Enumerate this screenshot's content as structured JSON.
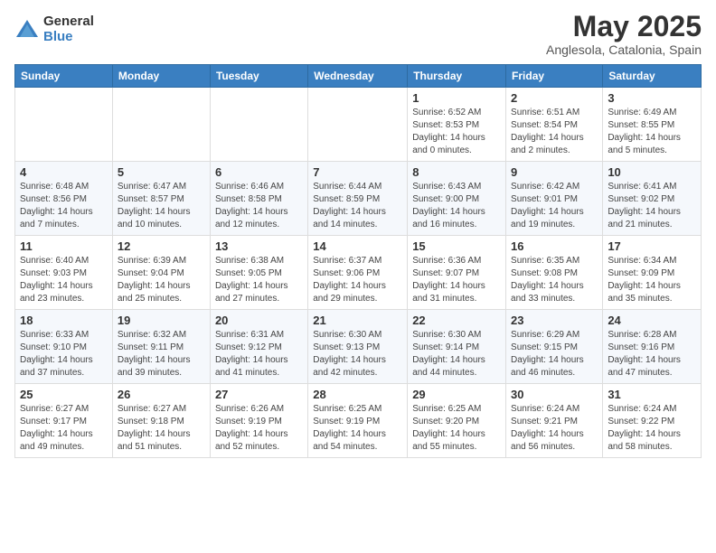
{
  "header": {
    "logo_general": "General",
    "logo_blue": "Blue",
    "title": "May 2025",
    "subtitle": "Anglesola, Catalonia, Spain"
  },
  "days_of_week": [
    "Sunday",
    "Monday",
    "Tuesday",
    "Wednesday",
    "Thursday",
    "Friday",
    "Saturday"
  ],
  "weeks": [
    [
      {
        "day": "",
        "info": ""
      },
      {
        "day": "",
        "info": ""
      },
      {
        "day": "",
        "info": ""
      },
      {
        "day": "",
        "info": ""
      },
      {
        "day": "1",
        "info": "Sunrise: 6:52 AM\nSunset: 8:53 PM\nDaylight: 14 hours and 0 minutes."
      },
      {
        "day": "2",
        "info": "Sunrise: 6:51 AM\nSunset: 8:54 PM\nDaylight: 14 hours and 2 minutes."
      },
      {
        "day": "3",
        "info": "Sunrise: 6:49 AM\nSunset: 8:55 PM\nDaylight: 14 hours and 5 minutes."
      }
    ],
    [
      {
        "day": "4",
        "info": "Sunrise: 6:48 AM\nSunset: 8:56 PM\nDaylight: 14 hours and 7 minutes."
      },
      {
        "day": "5",
        "info": "Sunrise: 6:47 AM\nSunset: 8:57 PM\nDaylight: 14 hours and 10 minutes."
      },
      {
        "day": "6",
        "info": "Sunrise: 6:46 AM\nSunset: 8:58 PM\nDaylight: 14 hours and 12 minutes."
      },
      {
        "day": "7",
        "info": "Sunrise: 6:44 AM\nSunset: 8:59 PM\nDaylight: 14 hours and 14 minutes."
      },
      {
        "day": "8",
        "info": "Sunrise: 6:43 AM\nSunset: 9:00 PM\nDaylight: 14 hours and 16 minutes."
      },
      {
        "day": "9",
        "info": "Sunrise: 6:42 AM\nSunset: 9:01 PM\nDaylight: 14 hours and 19 minutes."
      },
      {
        "day": "10",
        "info": "Sunrise: 6:41 AM\nSunset: 9:02 PM\nDaylight: 14 hours and 21 minutes."
      }
    ],
    [
      {
        "day": "11",
        "info": "Sunrise: 6:40 AM\nSunset: 9:03 PM\nDaylight: 14 hours and 23 minutes."
      },
      {
        "day": "12",
        "info": "Sunrise: 6:39 AM\nSunset: 9:04 PM\nDaylight: 14 hours and 25 minutes."
      },
      {
        "day": "13",
        "info": "Sunrise: 6:38 AM\nSunset: 9:05 PM\nDaylight: 14 hours and 27 minutes."
      },
      {
        "day": "14",
        "info": "Sunrise: 6:37 AM\nSunset: 9:06 PM\nDaylight: 14 hours and 29 minutes."
      },
      {
        "day": "15",
        "info": "Sunrise: 6:36 AM\nSunset: 9:07 PM\nDaylight: 14 hours and 31 minutes."
      },
      {
        "day": "16",
        "info": "Sunrise: 6:35 AM\nSunset: 9:08 PM\nDaylight: 14 hours and 33 minutes."
      },
      {
        "day": "17",
        "info": "Sunrise: 6:34 AM\nSunset: 9:09 PM\nDaylight: 14 hours and 35 minutes."
      }
    ],
    [
      {
        "day": "18",
        "info": "Sunrise: 6:33 AM\nSunset: 9:10 PM\nDaylight: 14 hours and 37 minutes."
      },
      {
        "day": "19",
        "info": "Sunrise: 6:32 AM\nSunset: 9:11 PM\nDaylight: 14 hours and 39 minutes."
      },
      {
        "day": "20",
        "info": "Sunrise: 6:31 AM\nSunset: 9:12 PM\nDaylight: 14 hours and 41 minutes."
      },
      {
        "day": "21",
        "info": "Sunrise: 6:30 AM\nSunset: 9:13 PM\nDaylight: 14 hours and 42 minutes."
      },
      {
        "day": "22",
        "info": "Sunrise: 6:30 AM\nSunset: 9:14 PM\nDaylight: 14 hours and 44 minutes."
      },
      {
        "day": "23",
        "info": "Sunrise: 6:29 AM\nSunset: 9:15 PM\nDaylight: 14 hours and 46 minutes."
      },
      {
        "day": "24",
        "info": "Sunrise: 6:28 AM\nSunset: 9:16 PM\nDaylight: 14 hours and 47 minutes."
      }
    ],
    [
      {
        "day": "25",
        "info": "Sunrise: 6:27 AM\nSunset: 9:17 PM\nDaylight: 14 hours and 49 minutes."
      },
      {
        "day": "26",
        "info": "Sunrise: 6:27 AM\nSunset: 9:18 PM\nDaylight: 14 hours and 51 minutes."
      },
      {
        "day": "27",
        "info": "Sunrise: 6:26 AM\nSunset: 9:19 PM\nDaylight: 14 hours and 52 minutes."
      },
      {
        "day": "28",
        "info": "Sunrise: 6:25 AM\nSunset: 9:19 PM\nDaylight: 14 hours and 54 minutes."
      },
      {
        "day": "29",
        "info": "Sunrise: 6:25 AM\nSunset: 9:20 PM\nDaylight: 14 hours and 55 minutes."
      },
      {
        "day": "30",
        "info": "Sunrise: 6:24 AM\nSunset: 9:21 PM\nDaylight: 14 hours and 56 minutes."
      },
      {
        "day": "31",
        "info": "Sunrise: 6:24 AM\nSunset: 9:22 PM\nDaylight: 14 hours and 58 minutes."
      }
    ]
  ]
}
